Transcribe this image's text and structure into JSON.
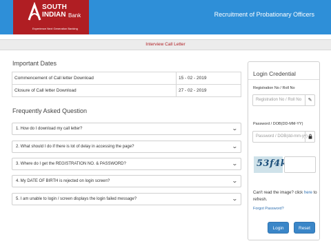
{
  "header": {
    "brand_line1": "SOUTH",
    "brand_line2": "INDIAN",
    "brand_bank": "Bank",
    "tagline": "Experience Next Generation Banking",
    "title": "Recruitment of Probationary Officers",
    "brand_color": "#b01e23",
    "bar_color": "#2e8fd8"
  },
  "subbar": {
    "label": "Interview Call Letter"
  },
  "important_dates": {
    "title": "Important Dates",
    "rows": [
      {
        "label": "Commencement of Call letter Download",
        "date": "15 - 02 - 2019"
      },
      {
        "label": "Closure of Call letter Download",
        "date": "27 - 02 - 2019"
      }
    ]
  },
  "faq": {
    "title": "Frequently Asked Question",
    "items": [
      "1. How do I download my call letter?",
      "2. What should I do if there is lot of delay in accessing the page?",
      "3. Where do I get the REGISTRATION NO. & PASSWORD?",
      "4. My DATE OF BIRTH is rejected on login screen?",
      "5. I am unable to login / screen displays the login failed message?"
    ],
    "chevron_icon": "chevron-down-icon"
  },
  "login": {
    "title": "Login Credential",
    "reg_label": "Registration No / Roll No",
    "reg_placeholder": "Registration No / Roll No",
    "reg_icon": "pencil-icon",
    "pwd_label": "Password / DOB(DD-MM-YY)",
    "pwd_placeholder": "Password / DOB(dd-mm-yy)",
    "pwd_icon": "lock-icon",
    "captcha_text": "53f4k",
    "cant_read_prefix": "Can't read the image? click ",
    "cant_read_link": "here",
    "cant_read_suffix": " to refresh.",
    "forgot": "Forgot Password?",
    "login_button": "Login",
    "reset_button": "Reset",
    "button_color": "#3a86c8"
  }
}
